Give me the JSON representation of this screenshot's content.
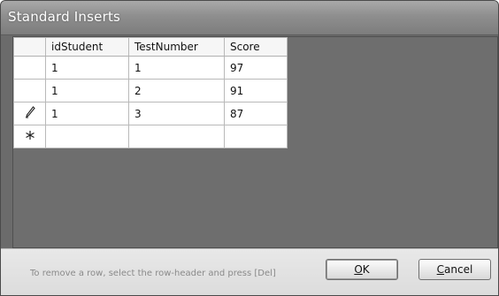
{
  "window": {
    "title": "Standard Inserts"
  },
  "grid": {
    "columns": [
      "idStudent",
      "TestNumber",
      "Score"
    ],
    "rows": [
      {
        "indicator": "",
        "idStudent": "1",
        "TestNumber": "1",
        "Score": "97"
      },
      {
        "indicator": "",
        "idStudent": "1",
        "TestNumber": "2",
        "Score": "91"
      },
      {
        "indicator": "pencil-icon",
        "idStudent": "1",
        "TestNumber": "3",
        "Score": "87"
      }
    ],
    "new_row_indicator": "asterisk-icon"
  },
  "footer": {
    "hint": "To remove a row, select the row-header and press [Del]",
    "ok": {
      "mnemonic": "O",
      "rest": "K"
    },
    "cancel": {
      "mnemonic": "C",
      "rest": "ancel"
    }
  },
  "colors": {
    "title_bar": "#8e8e8e",
    "grid_background": "#6e6e6e",
    "footer_background": "#dcdcdc"
  }
}
